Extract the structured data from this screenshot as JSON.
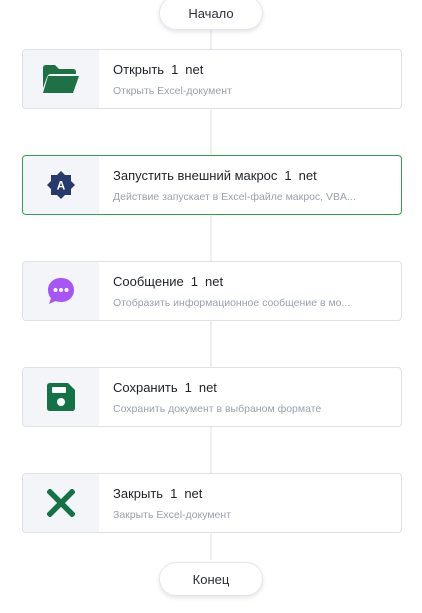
{
  "flow": {
    "start_label": "Начало",
    "end_label": "Конец",
    "nodes": [
      {
        "title": "Открыть",
        "count": "1",
        "unit": "net",
        "description": "Открыть Excel-документ",
        "icon": "folder-icon",
        "icon_color": "#1e7145",
        "selected": false
      },
      {
        "title": "Запустить внешний макрос",
        "count": "1",
        "unit": "net",
        "description": "Действие запускает в Excel-файле макрос, VBA...",
        "icon": "macro-badge-icon",
        "icon_color": "#263b6b",
        "selected": true
      },
      {
        "title": "Сообщение",
        "count": "1",
        "unit": "net",
        "description": "Отобразить информационное сообщение в мо...",
        "icon": "chat-bubble-icon",
        "icon_color": "#a855f7",
        "selected": false
      },
      {
        "title": "Сохранить",
        "count": "1",
        "unit": "net",
        "description": "Сохранить документ в выбраном формате",
        "icon": "save-icon",
        "icon_color": "#137347",
        "selected": false
      },
      {
        "title": "Закрыть",
        "count": "1",
        "unit": "net",
        "description": "Закрыть Excel-документ",
        "icon": "close-icon",
        "icon_color": "#137347",
        "selected": false
      }
    ]
  },
  "colors": {
    "selected_border": "#2ea04f",
    "connector": "#eeeff3"
  }
}
